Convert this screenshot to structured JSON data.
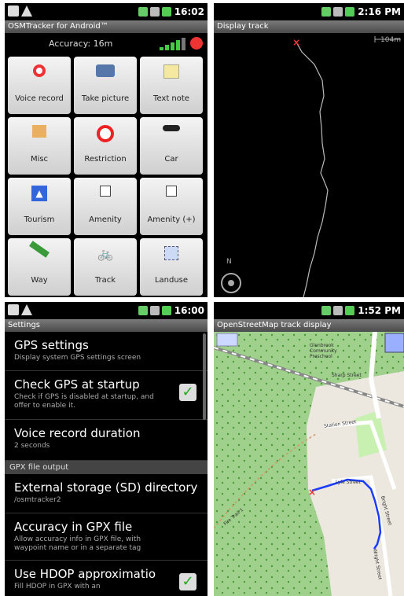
{
  "p1": {
    "time": "16:02",
    "title": "OSMTracker for Android™",
    "accuracy": "Accuracy: 16m",
    "buttons": [
      {
        "label": "Voice record",
        "icon": "microphone-icon"
      },
      {
        "label": "Take picture",
        "icon": "camera-icon"
      },
      {
        "label": "Text note",
        "icon": "notepad-icon"
      },
      {
        "label": "Misc",
        "icon": "box-icon"
      },
      {
        "label": "Restriction",
        "icon": "no-entry-icon"
      },
      {
        "label": "Car",
        "icon": "car-icon"
      },
      {
        "label": "Tourism",
        "icon": "tourism-icon"
      },
      {
        "label": "Amenity",
        "icon": "amenity-icon"
      },
      {
        "label": "Amenity (+)",
        "icon": "amenity-plus-icon"
      },
      {
        "label": "Way",
        "icon": "way-icon"
      },
      {
        "label": "Track",
        "icon": "bicycle-icon"
      },
      {
        "label": "Landuse",
        "icon": "landuse-icon"
      }
    ]
  },
  "p2": {
    "time": "2:16 PM",
    "title": "Display track",
    "scale": "104m",
    "north": "N"
  },
  "p3": {
    "time": "16:00",
    "title": "Settings",
    "items": [
      {
        "title": "GPS settings",
        "summary": "Display system GPS settings screen"
      },
      {
        "title": "Check GPS at startup",
        "summary": "Check if GPS is disabled at startup, and offer to enable it."
      },
      {
        "title": "Voice record duration",
        "summary": "2 seconds"
      }
    ],
    "section": "GPX file output",
    "items2": [
      {
        "title": "External storage (SD) directory",
        "summary": "/osmtracker2"
      },
      {
        "title": "Accuracy in GPX file",
        "summary": "Allow accuracy info in GPX file, with waypoint name or in a separate tag"
      },
      {
        "title": "Use HDOP approximatio",
        "summary": "Fill HDOP in GPX with an"
      }
    ]
  },
  "p4": {
    "time": "1:52 PM",
    "title": "OpenStreetMap track display",
    "labels": [
      {
        "text": "Glenbrook Community Preschool"
      },
      {
        "text": "Sharp Street"
      },
      {
        "text": "Station Street"
      },
      {
        "text": "Lyle Street"
      },
      {
        "text": "Bright Street"
      },
      {
        "text": "Wright Street"
      },
      {
        "text": "Fire Trail 1"
      }
    ]
  },
  "colors": {
    "track": "#1a3cff",
    "gpsbar": "#44cc44",
    "record": "#ee3333",
    "check": "#22aa22"
  }
}
